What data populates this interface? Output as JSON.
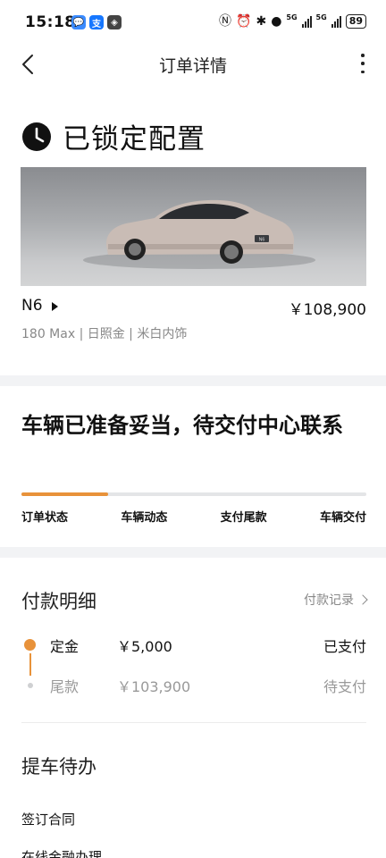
{
  "status_bar": {
    "time": "15:18",
    "apps": [
      "💬",
      "支",
      "◈"
    ],
    "network_1": "5G",
    "network_2": "5G",
    "battery": "89"
  },
  "nav": {
    "title": "订单详情"
  },
  "config": {
    "title": "已锁定配置",
    "model": "N6",
    "price": "￥108,900",
    "spec": "180 Max | 日照金 | 米白内饰",
    "car_badge": "N6"
  },
  "delivery": {
    "heading": "车辆已准备妥当，待交付中心联系",
    "progress": 0.25,
    "steps": [
      "订单状态",
      "车辆动态",
      "支付尾款",
      "车辆交付"
    ]
  },
  "payment": {
    "title": "付款明细",
    "link": "付款记录",
    "rows": [
      {
        "label": "定金",
        "amount": "￥5,000",
        "status": "已支付"
      },
      {
        "label": "尾款",
        "amount": "￥103,900",
        "status": "待支付"
      }
    ]
  },
  "todo": {
    "title": "提车待办",
    "items": [
      "签订合同",
      "在线金融办理"
    ]
  },
  "colors": {
    "accent": "#e8923a",
    "section_gap": "#f2f3f5",
    "muted_text": "#888888"
  }
}
